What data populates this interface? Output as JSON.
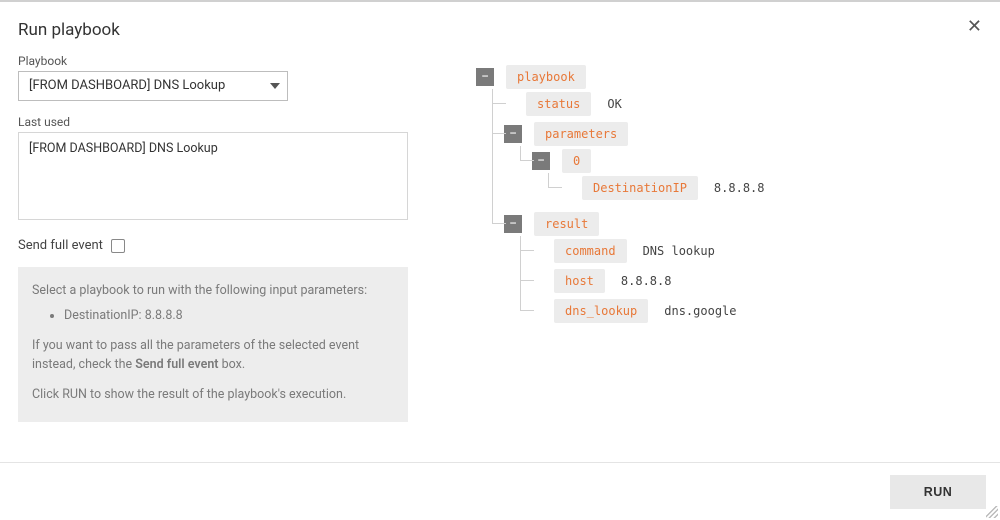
{
  "modal": {
    "title": "Run playbook",
    "close_icon": "✕"
  },
  "left": {
    "playbook_label": "Playbook",
    "playbook_selected": "[FROM DASHBOARD] DNS Lookup",
    "last_used_label": "Last used",
    "last_used_value": "[FROM DASHBOARD] DNS Lookup",
    "send_full_event_label": "Send full event",
    "send_full_event_checked": false,
    "info_line1": "Select a playbook to run with the following input parameters:",
    "info_bullet": "DestinationIP: 8.8.8.8",
    "info_line2_a": "If you want to pass all the parameters of the selected event instead, check the ",
    "info_line2_b": "Send full event",
    "info_line2_c": " box.",
    "info_line3": "Click RUN to show the result of the playbook's execution."
  },
  "tree": {
    "root_key": "playbook",
    "status_key": "status",
    "status_val": "OK",
    "parameters_key": "parameters",
    "param0_key": "0",
    "param0_field_key": "DestinationIP",
    "param0_field_val": "8.8.8.8",
    "result_key": "result",
    "result": {
      "command_key": "command",
      "command_val": "DNS lookup",
      "host_key": "host",
      "host_val": "8.8.8.8",
      "dns_lookup_key": "dns_lookup",
      "dns_lookup_val": "dns.google"
    }
  },
  "footer": {
    "run_label": "RUN"
  }
}
